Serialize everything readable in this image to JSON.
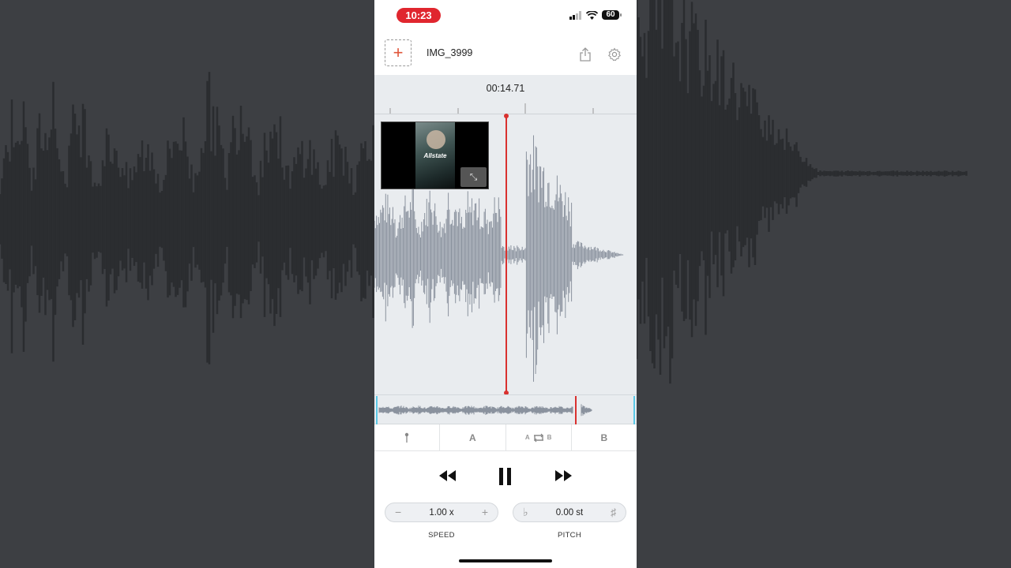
{
  "status_bar": {
    "time": "10:23",
    "battery": "60"
  },
  "header": {
    "add_label": "+",
    "file_name": "IMG_3999",
    "share_icon": "share-icon",
    "settings_icon": "gear-icon"
  },
  "waveform": {
    "time_display": "00:14.71",
    "accent_color": "#d9312f",
    "wave_color": "#8a929e"
  },
  "video": {
    "brand_text": "Allstate",
    "expand_icon": "expand-icon"
  },
  "loop_bar": {
    "marker_icon": "pin-icon",
    "a_label": "A",
    "loop_a": "A",
    "loop_b": "B",
    "b_label": "B"
  },
  "transport": {
    "rewind_icon": "rewind-icon",
    "pause_icon": "pause-icon",
    "ff_icon": "fast-forward-icon"
  },
  "speed": {
    "minus": "−",
    "value": "1.00 x",
    "plus": "+",
    "label": "SPEED"
  },
  "pitch": {
    "flat": "♭",
    "value": "0.00 st",
    "sharp": "♯",
    "label": "PITCH"
  }
}
